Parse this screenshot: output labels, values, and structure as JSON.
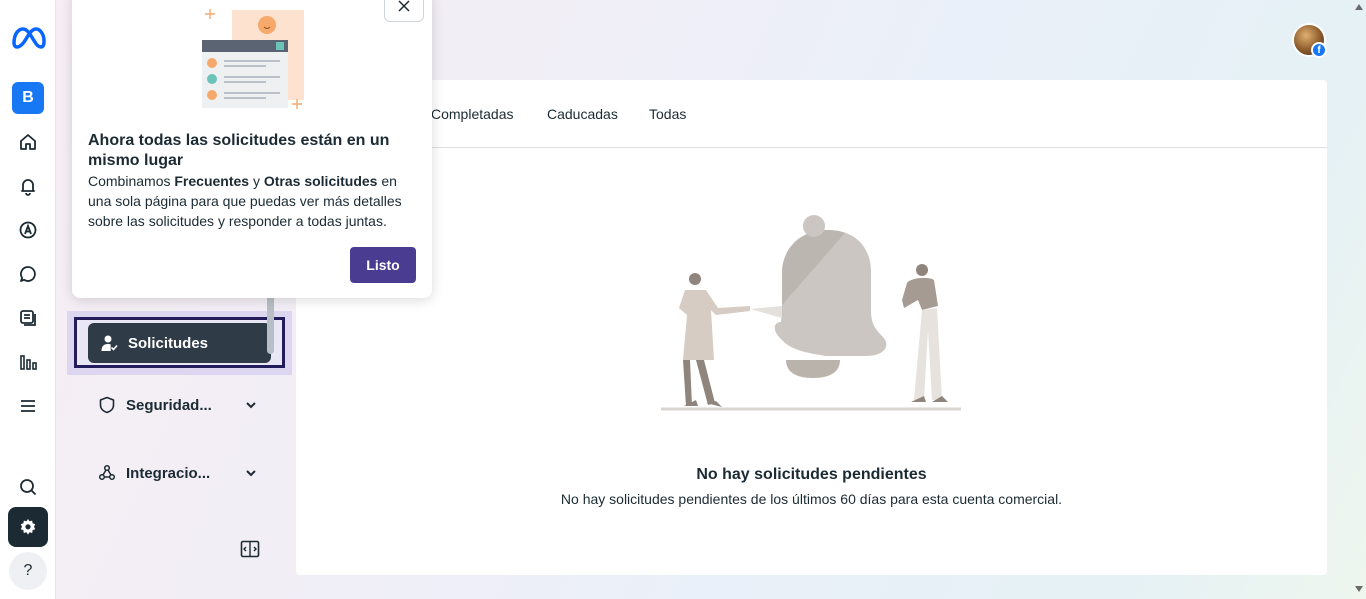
{
  "rail": {
    "business_initial": "B",
    "help_label": "?",
    "icons": [
      "meta-logo",
      "home-icon",
      "bell-icon",
      "ads-icon",
      "chat-icon",
      "pages-icon",
      "insights-icon",
      "menu-icon",
      "search-icon",
      "gear-icon",
      "help-icon"
    ]
  },
  "sidebar": {
    "selected_label": "Solicitudes",
    "items": [
      {
        "label": "Seguridad..."
      },
      {
        "label": "Integracio..."
      }
    ]
  },
  "tabs": [
    "Completadas",
    "Caducadas",
    "Todas"
  ],
  "empty_state": {
    "title": "No hay solicitudes pendientes",
    "description": "No hay solicitudes pendientes de los últimos 60 días para esta cuenta comercial."
  },
  "popover": {
    "title": "Ahora todas las solicitudes están en un mismo lugar",
    "body_prefix": "Combinamos ",
    "body_bold1": "Frecuentes",
    "body_mid": " y ",
    "body_bold2": "Otras solicitudes",
    "body_suffix": " en una sola página para que puedas ver más detalles sobre las solicitudes y responder a todas juntas.",
    "button_label": "Listo"
  },
  "profile": {
    "badge": "f"
  },
  "colors": {
    "accent": "#4a3d91",
    "brand": "#1877f2",
    "selected": "#2f3b47"
  }
}
